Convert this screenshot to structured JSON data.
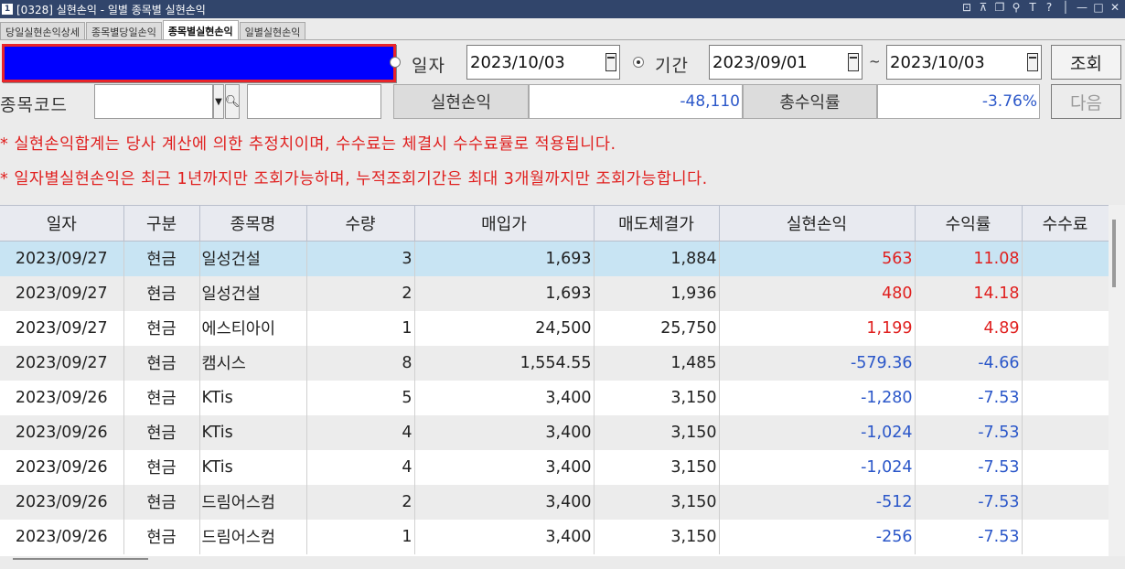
{
  "window": {
    "title": "[0328] 실현손익 - 일별 종목별 실현손익",
    "controls": [
      "⊡",
      "⊼",
      "❐",
      "⚲",
      "T",
      "?",
      "│",
      "—",
      "□",
      "✕"
    ]
  },
  "tabs": [
    {
      "label": "당일실현손익상세"
    },
    {
      "label": "종목별당일손익"
    },
    {
      "label": "종목별실현손익"
    },
    {
      "label": "일별실현손익"
    }
  ],
  "query": {
    "date_label": "일자",
    "date_value": "2023/10/03",
    "period_label": "기간",
    "period_from": "2023/09/01",
    "tilde": "~",
    "period_to": "2023/10/03",
    "search_button": "조회",
    "stock_code_label": "종목코드",
    "stock_code_value": "",
    "stock_name_value": "",
    "realized_pl_label": "실현손익",
    "realized_pl_value": "-48,110",
    "total_return_label": "총수익률",
    "total_return_value": "-3.76%",
    "next_button": "다음"
  },
  "notices": [
    "* 실현손익합계는 당사 계산에 의한 추정치이며, 수수료는 체결시 수수료률로 적용됩니다.",
    "* 일자별실현손익은 최근 1년까지만 조회가능하며, 누적조회기간은 최대 3개월까지만 조회가능합니다."
  ],
  "table": {
    "columns": [
      "일자",
      "구분",
      "종목명",
      "수량",
      "매입가",
      "매도체결가",
      "실현손익",
      "수익률",
      "수수료"
    ],
    "rows": [
      {
        "date": "2023/09/27",
        "type": "현금",
        "name": "일성건설",
        "qty": "3",
        "buy": "1,693",
        "sell": "1,884",
        "pl": "563",
        "ret": "11.08",
        "fee": ""
      },
      {
        "date": "2023/09/27",
        "type": "현금",
        "name": "일성건설",
        "qty": "2",
        "buy": "1,693",
        "sell": "1,936",
        "pl": "480",
        "ret": "14.18",
        "fee": ""
      },
      {
        "date": "2023/09/27",
        "type": "현금",
        "name": "에스티아이",
        "qty": "1",
        "buy": "24,500",
        "sell": "25,750",
        "pl": "1,199",
        "ret": "4.89",
        "fee": ""
      },
      {
        "date": "2023/09/27",
        "type": "현금",
        "name": "캠시스",
        "qty": "8",
        "buy": "1,554.55",
        "sell": "1,485",
        "pl": "-579.36",
        "ret": "-4.66",
        "fee": ""
      },
      {
        "date": "2023/09/26",
        "type": "현금",
        "name": "KTis",
        "qty": "5",
        "buy": "3,400",
        "sell": "3,150",
        "pl": "-1,280",
        "ret": "-7.53",
        "fee": ""
      },
      {
        "date": "2023/09/26",
        "type": "현금",
        "name": "KTis",
        "qty": "4",
        "buy": "3,400",
        "sell": "3,150",
        "pl": "-1,024",
        "ret": "-7.53",
        "fee": ""
      },
      {
        "date": "2023/09/26",
        "type": "현금",
        "name": "KTis",
        "qty": "4",
        "buy": "3,400",
        "sell": "3,150",
        "pl": "-1,024",
        "ret": "-7.53",
        "fee": ""
      },
      {
        "date": "2023/09/26",
        "type": "현금",
        "name": "드림어스컴",
        "qty": "2",
        "buy": "3,400",
        "sell": "3,150",
        "pl": "-512",
        "ret": "-7.53",
        "fee": ""
      },
      {
        "date": "2023/09/26",
        "type": "현금",
        "name": "드림어스컴",
        "qty": "1",
        "buy": "3,400",
        "sell": "3,150",
        "pl": "-256",
        "ret": "-7.53",
        "fee": ""
      }
    ]
  },
  "colors": {
    "positive": "#e0201f",
    "negative": "#2b57c9",
    "selected_row": "#c8e4f3",
    "titlebar": "#31456b"
  }
}
